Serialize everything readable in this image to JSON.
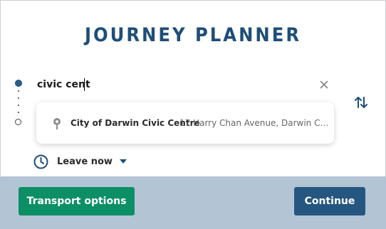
{
  "header": {
    "title": "JOURNEY PLANNER"
  },
  "origin": {
    "value": "civic cent"
  },
  "suggestions": [
    {
      "name": "City of Darwin Civic Centre",
      "address": "17 Harry Chan Avenue, Darwin City, ..."
    }
  ],
  "time": {
    "label": "Leave now"
  },
  "footer": {
    "transport_label": "Transport options",
    "continue_label": "Continue"
  },
  "colors": {
    "title": "#1e4e79",
    "footer_bg": "#b3c5d5",
    "transport_button": "#0d8f66",
    "continue_button": "#245680"
  }
}
